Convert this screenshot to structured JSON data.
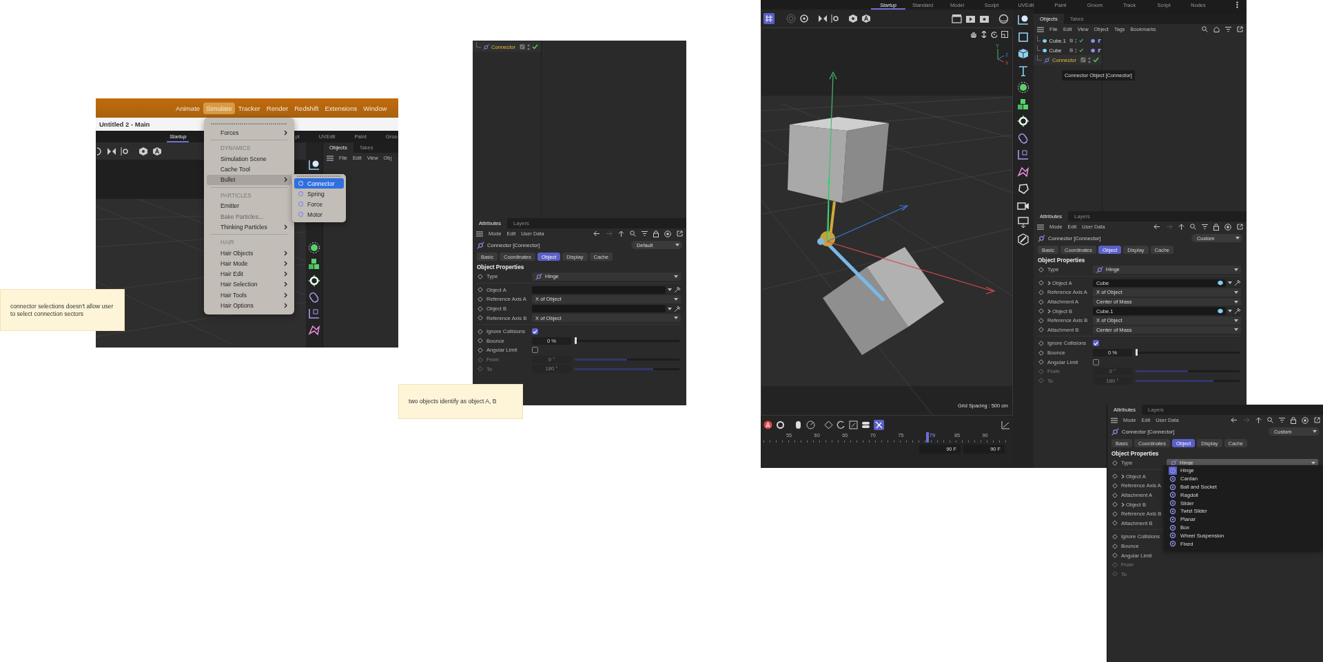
{
  "notes": [
    {
      "text": "connector selections doesn't allow user to select connection sectors"
    },
    {
      "text": "two objects identify as object A, B"
    }
  ],
  "menu_capture": {
    "menubar": [
      {
        "label": "Animate",
        "selected": false
      },
      {
        "label": "Simulate",
        "selected": true
      },
      {
        "label": "Tracker",
        "selected": false
      },
      {
        "label": "Render",
        "selected": false
      },
      {
        "label": "Redshift",
        "selected": false
      },
      {
        "label": "Extensions",
        "selected": false
      },
      {
        "label": "Window",
        "selected": false
      }
    ],
    "document_title": "Untitled 2 - Main",
    "layout_tabs": [
      {
        "label": "Startup",
        "selected": true
      },
      {
        "label": "pt",
        "selected": false
      },
      {
        "label": "UVEdit",
        "selected": false
      },
      {
        "label": "Paint",
        "selected": false
      },
      {
        "label": "Groo",
        "selected": false
      }
    ],
    "objects_tabs": [
      {
        "label": "Objects",
        "selected": true
      },
      {
        "label": "Takes",
        "selected": false
      }
    ],
    "objects_menu": [
      "File",
      "Edit",
      "View",
      "Obj"
    ],
    "simulate_menu": [
      {
        "kind": "item",
        "label": "Forces",
        "submenu": true,
        "highlighted": false,
        "disabled": false
      },
      {
        "kind": "divider"
      },
      {
        "kind": "heading",
        "label": "DYNAMICS"
      },
      {
        "kind": "item",
        "label": "Simulation Scene",
        "submenu": false,
        "highlighted": false,
        "disabled": false
      },
      {
        "kind": "item",
        "label": "Cache Tool",
        "submenu": false,
        "highlighted": false,
        "disabled": false
      },
      {
        "kind": "item",
        "label": "Bullet",
        "submenu": true,
        "highlighted": true,
        "disabled": false
      },
      {
        "kind": "divider"
      },
      {
        "kind": "heading",
        "label": "PARTICLES"
      },
      {
        "kind": "item",
        "label": "Emitter",
        "submenu": false,
        "highlighted": false,
        "disabled": false
      },
      {
        "kind": "item",
        "label": "Bake Particles...",
        "submenu": false,
        "highlighted": false,
        "disabled": true
      },
      {
        "kind": "item",
        "label": "Thinking Particles",
        "submenu": true,
        "highlighted": false,
        "disabled": false
      },
      {
        "kind": "divider"
      },
      {
        "kind": "heading",
        "label": "HAIR"
      },
      {
        "kind": "item",
        "label": "Hair Objects",
        "submenu": true,
        "highlighted": false,
        "disabled": false
      },
      {
        "kind": "item",
        "label": "Hair Mode",
        "submenu": true,
        "highlighted": false,
        "disabled": false
      },
      {
        "kind": "item",
        "label": "Hair Edit",
        "submenu": true,
        "highlighted": false,
        "disabled": false
      },
      {
        "kind": "item",
        "label": "Hair Selection",
        "submenu": true,
        "highlighted": false,
        "disabled": false
      },
      {
        "kind": "item",
        "label": "Hair Tools",
        "submenu": true,
        "highlighted": false,
        "disabled": false
      },
      {
        "kind": "item",
        "label": "Hair Options",
        "submenu": true,
        "highlighted": false,
        "disabled": false
      }
    ],
    "bullet_submenu": [
      {
        "label": "Connector",
        "selected": true
      },
      {
        "label": "Spring",
        "selected": false
      },
      {
        "label": "Force",
        "selected": false
      },
      {
        "label": "Motor",
        "selected": false
      }
    ]
  },
  "editors": [
    {
      "kind": "connector_panel",
      "objects": {
        "rows": [
          {
            "name": "Connector",
            "kind": "connector",
            "selected": true
          }
        ]
      },
      "attributes": {
        "tabs": [
          {
            "label": "Attributes",
            "selected": true
          },
          {
            "label": "Layers",
            "selected": false
          }
        ],
        "menu": [
          "Mode",
          "Edit",
          "User Data"
        ],
        "object_name": "Connector [Connector]",
        "preset": "Default",
        "sections": [
          {
            "label": "Basic",
            "selected": false
          },
          {
            "label": "Coordinates",
            "selected": false
          },
          {
            "label": "Object",
            "selected": true
          },
          {
            "label": "Display",
            "selected": false
          },
          {
            "label": "Cache",
            "selected": false
          }
        ],
        "heading": "Object Properties",
        "property_groups": [
          [
            {
              "kind": "type",
              "label": "Type",
              "value": "Hinge",
              "disabled": false
            }
          ],
          [
            {
              "kind": "link",
              "label": "Object A",
              "disabled": false
            },
            {
              "kind": "dropdown",
              "label": "Reference Axis A",
              "value": "X of Object",
              "disabled": false
            },
            {
              "kind": "link",
              "label": "Object B",
              "disabled": false
            },
            {
              "kind": "dropdown",
              "label": "Reference Axis B",
              "value": "X of Object",
              "disabled": false
            }
          ],
          [
            {
              "kind": "checkbox",
              "label": "Ignore Collisions",
              "checked": true,
              "disabled": false
            },
            {
              "kind": "slider",
              "label": "Bounce",
              "value": "0 %",
              "level": 0,
              "disabled": false
            },
            {
              "kind": "checkbox",
              "label": "Angular Limit",
              "checked": false,
              "disabled": false
            },
            {
              "kind": "slider",
              "label": "From",
              "value": "0 °",
              "level": 0.5,
              "disabled": true
            },
            {
              "kind": "slider",
              "label": "To",
              "value": "180 °",
              "level": 0.75,
              "disabled": true
            }
          ]
        ]
      }
    },
    {
      "kind": "scene",
      "layout_tabs": [
        {
          "label": "Startup",
          "selected": true
        },
        {
          "label": "Standard",
          "selected": false
        },
        {
          "label": "Model",
          "selected": false
        },
        {
          "label": "Sculpt",
          "selected": false
        },
        {
          "label": "UVEdit",
          "selected": false
        },
        {
          "label": "Paint",
          "selected": false
        },
        {
          "label": "Groom",
          "selected": false
        },
        {
          "label": "Track",
          "selected": false
        },
        {
          "label": "Script",
          "selected": false
        },
        {
          "label": "Nodes",
          "selected": false
        }
      ],
      "viewport": {
        "axis_labels": [
          "Y",
          "Z",
          "X"
        ],
        "grid_spacing": "Grid Spacing : 500 cm"
      },
      "timeline": {
        "ticks": [
          {
            "label": "55",
            "selected": false
          },
          {
            "label": "60",
            "selected": false
          },
          {
            "label": "65",
            "selected": false
          },
          {
            "label": "70",
            "selected": false
          },
          {
            "label": "75",
            "selected": false
          },
          {
            "label": "79",
            "selected": true
          },
          {
            "label": "85",
            "selected": false
          },
          {
            "label": "90",
            "selected": false
          }
        ],
        "frame_fields": [
          "90 F",
          "90 F"
        ]
      },
      "objects": {
        "tabs": [
          {
            "label": "Objects",
            "selected": true
          },
          {
            "label": "Takes",
            "selected": false
          }
        ],
        "menu": [
          "File",
          "Edit",
          "View",
          "Object",
          "Tags",
          "Bookmarks"
        ],
        "rows": [
          {
            "name": "Cube.1",
            "kind": "cube",
            "selected": false
          },
          {
            "name": "Cube",
            "kind": "cube",
            "selected": false
          },
          {
            "name": "Connector",
            "kind": "connector",
            "selected": true
          }
        ],
        "tooltip": "Connector Object [Connector]"
      },
      "attributes": {
        "tabs": [
          {
            "label": "Attributes",
            "selected": true
          },
          {
            "label": "Layers",
            "selected": false
          }
        ],
        "menu": [
          "Mode",
          "Edit",
          "User Data"
        ],
        "object_name": "Connector [Connector]",
        "preset": "Custom",
        "sections": [
          {
            "label": "Basic",
            "selected": false
          },
          {
            "label": "Coordinates",
            "selected": false
          },
          {
            "label": "Object",
            "selected": true
          },
          {
            "label": "Display",
            "selected": false
          },
          {
            "label": "Cache",
            "selected": false
          }
        ],
        "heading": "Object Properties",
        "property_groups": [
          [
            {
              "kind": "type",
              "label": "Type",
              "value": "Hinge",
              "disabled": false
            }
          ],
          [
            {
              "kind": "link",
              "label": "Object A",
              "value": "Cube",
              "expanded": false,
              "disabled": false
            },
            {
              "kind": "dropdown",
              "label": "Reference Axis A",
              "value": "X of Object",
              "disabled": false
            },
            {
              "kind": "dropdown",
              "label": "Attachment A",
              "value": "Center of Mass",
              "disabled": false
            },
            {
              "kind": "link",
              "label": "Object B",
              "value": "Cube.1",
              "expanded": false,
              "disabled": false
            },
            {
              "kind": "dropdown",
              "label": "Reference Axis B",
              "value": "X of Object",
              "disabled": false
            },
            {
              "kind": "dropdown",
              "label": "Attachment B",
              "value": "Center of Mass",
              "disabled": false
            }
          ],
          [
            {
              "kind": "checkbox",
              "label": "Ignore Collisions",
              "checked": true,
              "disabled": false
            },
            {
              "kind": "slider",
              "label": "Bounce",
              "value": "0 %",
              "level": 0,
              "disabled": false
            },
            {
              "kind": "checkbox",
              "label": "Angular Limit",
              "checked": false,
              "disabled": false
            },
            {
              "kind": "slider",
              "label": "From",
              "value": "0 °",
              "level": 0.5,
              "disabled": true
            },
            {
              "kind": "slider",
              "label": "To",
              "value": "180 °",
              "level": 0.75,
              "disabled": true
            }
          ]
        ]
      }
    },
    {
      "kind": "type_menu",
      "attributes": {
        "tabs": [
          {
            "label": "Attributes",
            "selected": true
          },
          {
            "label": "Layers",
            "selected": false
          }
        ],
        "menu": [
          "Mode",
          "Edit",
          "User Data"
        ],
        "object_name": "Connector [Connector]",
        "preset": "Custom",
        "sections": [
          {
            "label": "Basic",
            "selected": false
          },
          {
            "label": "Coordinates",
            "selected": false
          },
          {
            "label": "Object",
            "selected": true
          },
          {
            "label": "Display",
            "selected": false
          },
          {
            "label": "Cache",
            "selected": false
          }
        ],
        "heading": "Object Properties",
        "property_groups": [
          [
            {
              "kind": "type",
              "label": "Type",
              "value": "Hinge",
              "disabled": false
            }
          ],
          [
            {
              "kind": "covered",
              "label": "Object A",
              "expanded": false,
              "disabled": false
            },
            {
              "kind": "covered",
              "label": "Reference Axis A",
              "disabled": false
            },
            {
              "kind": "covered",
              "label": "Attachment A",
              "disabled": false
            },
            {
              "kind": "covered",
              "label": "Object B",
              "expanded": false,
              "disabled": false
            },
            {
              "kind": "covered",
              "label": "Reference Axis B",
              "disabled": false
            },
            {
              "kind": "covered",
              "label": "Attachment B",
              "disabled": false
            }
          ],
          [
            {
              "kind": "covered",
              "label": "Ignore Collisions",
              "disabled": false
            },
            {
              "kind": "covered",
              "label": "Bounce",
              "disabled": false
            },
            {
              "kind": "covered",
              "label": "Angular Limit",
              "disabled": false
            },
            {
              "kind": "covered",
              "label": "From",
              "disabled": true
            },
            {
              "kind": "covered",
              "label": "To",
              "disabled": true
            }
          ]
        ],
        "type_menu": [
          {
            "label": "Hinge",
            "selected": true
          },
          {
            "label": "Cardan",
            "selected": false
          },
          {
            "label": "Ball and Socket",
            "selected": false
          },
          {
            "label": "Ragdoll",
            "selected": false
          },
          {
            "label": "Slider",
            "selected": false
          },
          {
            "label": "Twist Slider",
            "selected": false
          },
          {
            "label": "Planar",
            "selected": false
          },
          {
            "label": "Box",
            "selected": false
          },
          {
            "label": "Wheel Suspension",
            "selected": false
          },
          {
            "label": "Fixed",
            "selected": false
          }
        ]
      }
    }
  ]
}
